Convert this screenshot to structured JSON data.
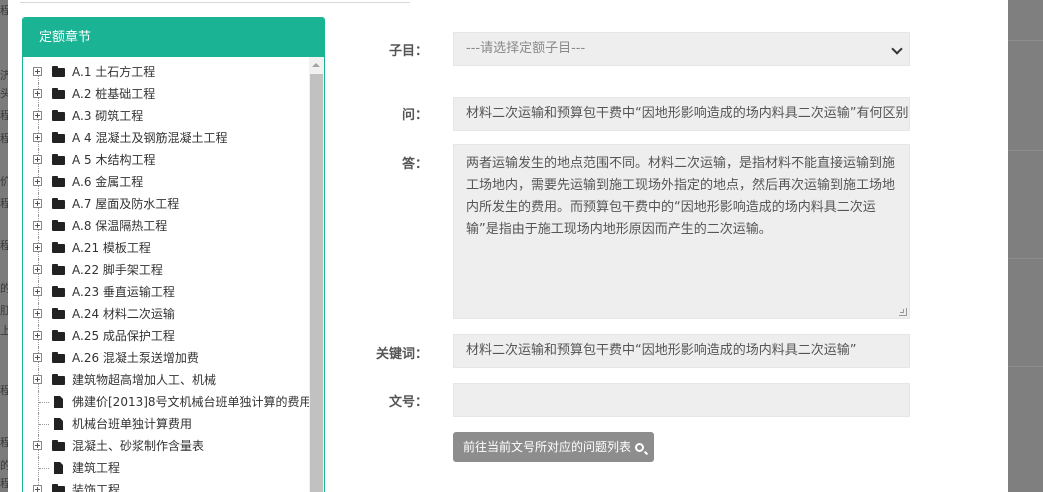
{
  "background_fragments": [
    "程",
    "济",
    "头",
    "程",
    "程",
    "价",
    "程",
    "程",
    "的",
    "肛",
    "上",
    "程",
    "程",
    "的",
    "程"
  ],
  "tree": {
    "header": "定额章节",
    "items": [
      {
        "label": "A.1 土石方工程",
        "type": "folder"
      },
      {
        "label": "A.2 桩基础工程",
        "type": "folder"
      },
      {
        "label": "A.3 砌筑工程",
        "type": "folder"
      },
      {
        "label": "A 4 混凝土及钢筋混凝土工程",
        "type": "folder"
      },
      {
        "label": "A 5 木结构工程",
        "type": "folder"
      },
      {
        "label": "A.6 金属工程",
        "type": "folder"
      },
      {
        "label": "A.7 屋面及防水工程",
        "type": "folder"
      },
      {
        "label": "A.8 保温隔热工程",
        "type": "folder"
      },
      {
        "label": "A.21 模板工程",
        "type": "folder"
      },
      {
        "label": "A.22 脚手架工程",
        "type": "folder"
      },
      {
        "label": "A.23 垂直运输工程",
        "type": "folder"
      },
      {
        "label": "A.24 材料二次运输",
        "type": "folder"
      },
      {
        "label": "A.25 成品保护工程",
        "type": "folder"
      },
      {
        "label": "A.26 混凝土泵送增加费",
        "type": "folder"
      },
      {
        "label": "建筑物超高增加人工、机械",
        "type": "folder"
      },
      {
        "label": "佛建价[2013]8号文机械台班单独计算的费用",
        "type": "file"
      },
      {
        "label": "机械台班单独计算费用",
        "type": "file"
      },
      {
        "label": "混凝土、砂浆制作含量表",
        "type": "folder"
      },
      {
        "label": "建筑工程",
        "type": "file"
      },
      {
        "label": "装饰工程",
        "type": "folder"
      }
    ]
  },
  "form": {
    "subitem_label": "子目：",
    "subitem_placeholder": "---请选择定额子目---",
    "question_label": "问：",
    "question_value": "材料二次运输和预算包干费中“因地形影响造成的场内料具二次运输”有何区别？",
    "answer_label": "答：",
    "answer_value": "两者运输发生的地点范围不同。材料二次运输，是指材料不能直接运输到施工场地内，需要先运输到施工现场外指定的地点，然后再次运输到施工场地内所发生的费用。而预算包干费中的“因地形影响造成的场内料具二次运输”是指由于施工现场内地形原因而产生的二次运输。",
    "keyword_label": "关键词：",
    "keyword_value": "材料二次运输和预算包干费中“因地形影响造成的场内料具二次运输”",
    "docno_label": "文号：",
    "docno_value": "",
    "button_label": "前往当前文号所对应的问题列表"
  }
}
